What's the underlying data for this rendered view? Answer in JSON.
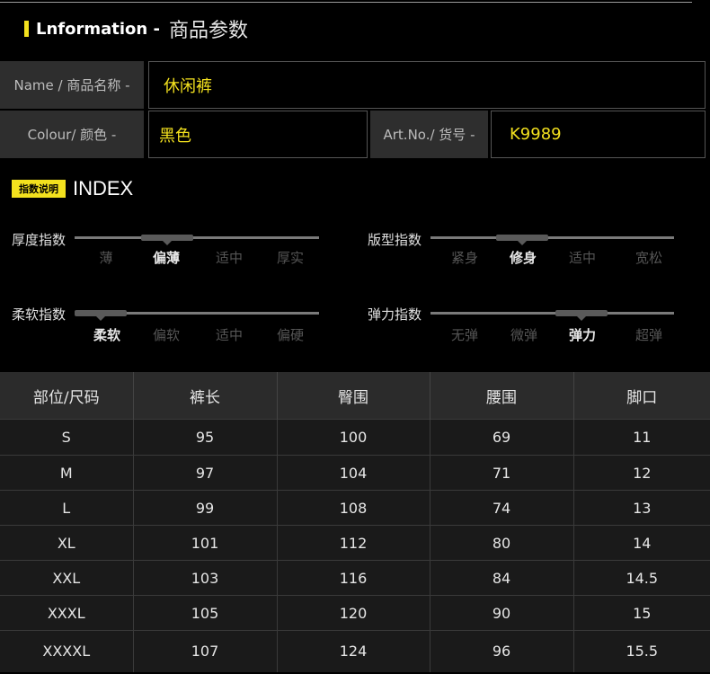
{
  "header": {
    "en": "Lnformation -",
    "cn": "商品参数"
  },
  "fields": {
    "name_label": "Name / 商品名称 -",
    "name_value": "休闲裤",
    "colour_label": "Colour/ 颜色 -",
    "colour_value": "黑色",
    "artno_label": "Art.No./ 货号 -",
    "artno_value": "K9989"
  },
  "index": {
    "tag": "指数说明",
    "title": "INDEX",
    "sliders": [
      {
        "name": "厚度指数",
        "options": [
          "薄",
          "偏薄",
          "适中",
          "厚实"
        ],
        "selected": 1
      },
      {
        "name": "版型指数",
        "options": [
          "紧身",
          "修身",
          "适中",
          "宽松"
        ],
        "selected": 1
      },
      {
        "name": "柔软指数",
        "options": [
          "柔软",
          "偏软",
          "适中",
          "偏硬"
        ],
        "selected": 0
      },
      {
        "name": "弹力指数",
        "options": [
          "无弹",
          "微弹",
          "弹力",
          "超弹"
        ],
        "selected": 2
      }
    ]
  },
  "size_table": {
    "headers": [
      "部位/尺码",
      "裤长",
      "臀围",
      "腰围",
      "脚口"
    ],
    "rows": [
      [
        "S",
        "95",
        "100",
        "69",
        "11"
      ],
      [
        "M",
        "97",
        "104",
        "71",
        "12"
      ],
      [
        "L",
        "99",
        "108",
        "74",
        "13"
      ],
      [
        "XL",
        "101",
        "112",
        "80",
        "14"
      ],
      [
        "XXL",
        "103",
        "116",
        "84",
        "14.5"
      ],
      [
        "XXXL",
        "105",
        "120",
        "90",
        "15"
      ],
      [
        "XXXXL",
        "107",
        "124",
        "96",
        "15.5"
      ]
    ]
  },
  "colors": {
    "accent": "#f3e11e",
    "background": "#000000",
    "label_bg": "#2e2e2e"
  }
}
